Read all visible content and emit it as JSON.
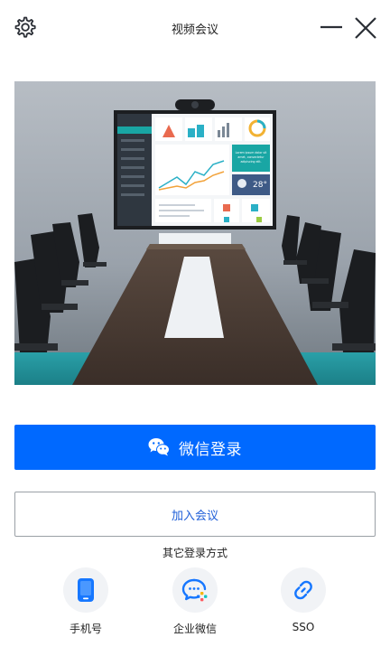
{
  "window": {
    "title": "视频会议",
    "settings_icon": "gear-icon",
    "minimize_icon": "minimize-icon",
    "close_icon": "close-icon"
  },
  "hero": {
    "description": "conference-room-with-dashboard-screen",
    "screen_text": {
      "card_line_1": "Lorem ipsum dolor sit",
      "card_line_2": "amet, consectetur",
      "card_line_3": "adipiscing elit.",
      "temperature": "28°"
    }
  },
  "actions": {
    "wechat_login_label": "微信登录",
    "wechat_icon": "wechat-icon",
    "join_meeting_label": "加入会议"
  },
  "other_login": {
    "title": "其它登录方式",
    "methods": [
      {
        "label": "手机号",
        "icon": "phone-icon"
      },
      {
        "label": "企业微信",
        "icon": "enterprise-wechat-icon"
      },
      {
        "label": "SSO",
        "icon": "link-icon"
      }
    ]
  },
  "colors": {
    "primary": "#0069ff",
    "link_text": "#1f5fd8",
    "icon_blue": "#1677ff"
  }
}
